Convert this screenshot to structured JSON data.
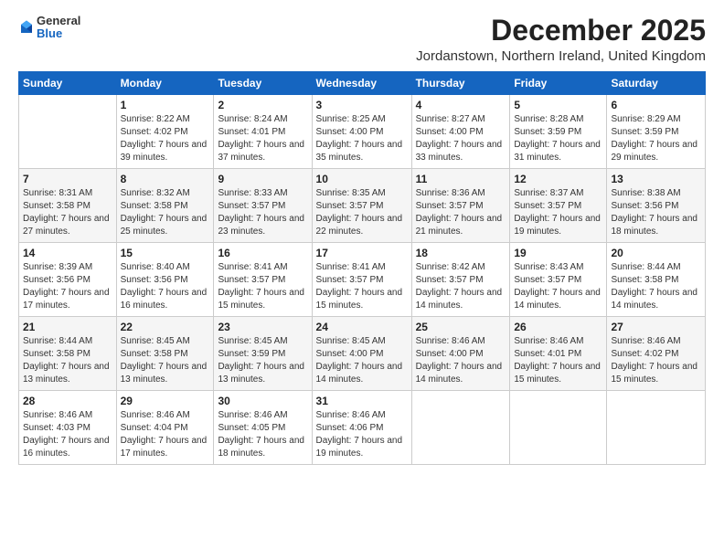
{
  "header": {
    "logo_general": "General",
    "logo_blue": "Blue",
    "month_title": "December 2025",
    "location": "Jordanstown, Northern Ireland, United Kingdom"
  },
  "weekdays": [
    "Sunday",
    "Monday",
    "Tuesday",
    "Wednesday",
    "Thursday",
    "Friday",
    "Saturday"
  ],
  "weeks": [
    [
      {
        "day": "",
        "sunrise": "",
        "sunset": "",
        "daylight": ""
      },
      {
        "day": "1",
        "sunrise": "Sunrise: 8:22 AM",
        "sunset": "Sunset: 4:02 PM",
        "daylight": "Daylight: 7 hours and 39 minutes."
      },
      {
        "day": "2",
        "sunrise": "Sunrise: 8:24 AM",
        "sunset": "Sunset: 4:01 PM",
        "daylight": "Daylight: 7 hours and 37 minutes."
      },
      {
        "day": "3",
        "sunrise": "Sunrise: 8:25 AM",
        "sunset": "Sunset: 4:00 PM",
        "daylight": "Daylight: 7 hours and 35 minutes."
      },
      {
        "day": "4",
        "sunrise": "Sunrise: 8:27 AM",
        "sunset": "Sunset: 4:00 PM",
        "daylight": "Daylight: 7 hours and 33 minutes."
      },
      {
        "day": "5",
        "sunrise": "Sunrise: 8:28 AM",
        "sunset": "Sunset: 3:59 PM",
        "daylight": "Daylight: 7 hours and 31 minutes."
      },
      {
        "day": "6",
        "sunrise": "Sunrise: 8:29 AM",
        "sunset": "Sunset: 3:59 PM",
        "daylight": "Daylight: 7 hours and 29 minutes."
      }
    ],
    [
      {
        "day": "7",
        "sunrise": "Sunrise: 8:31 AM",
        "sunset": "Sunset: 3:58 PM",
        "daylight": "Daylight: 7 hours and 27 minutes."
      },
      {
        "day": "8",
        "sunrise": "Sunrise: 8:32 AM",
        "sunset": "Sunset: 3:58 PM",
        "daylight": "Daylight: 7 hours and 25 minutes."
      },
      {
        "day": "9",
        "sunrise": "Sunrise: 8:33 AM",
        "sunset": "Sunset: 3:57 PM",
        "daylight": "Daylight: 7 hours and 23 minutes."
      },
      {
        "day": "10",
        "sunrise": "Sunrise: 8:35 AM",
        "sunset": "Sunset: 3:57 PM",
        "daylight": "Daylight: 7 hours and 22 minutes."
      },
      {
        "day": "11",
        "sunrise": "Sunrise: 8:36 AM",
        "sunset": "Sunset: 3:57 PM",
        "daylight": "Daylight: 7 hours and 21 minutes."
      },
      {
        "day": "12",
        "sunrise": "Sunrise: 8:37 AM",
        "sunset": "Sunset: 3:57 PM",
        "daylight": "Daylight: 7 hours and 19 minutes."
      },
      {
        "day": "13",
        "sunrise": "Sunrise: 8:38 AM",
        "sunset": "Sunset: 3:56 PM",
        "daylight": "Daylight: 7 hours and 18 minutes."
      }
    ],
    [
      {
        "day": "14",
        "sunrise": "Sunrise: 8:39 AM",
        "sunset": "Sunset: 3:56 PM",
        "daylight": "Daylight: 7 hours and 17 minutes."
      },
      {
        "day": "15",
        "sunrise": "Sunrise: 8:40 AM",
        "sunset": "Sunset: 3:56 PM",
        "daylight": "Daylight: 7 hours and 16 minutes."
      },
      {
        "day": "16",
        "sunrise": "Sunrise: 8:41 AM",
        "sunset": "Sunset: 3:57 PM",
        "daylight": "Daylight: 7 hours and 15 minutes."
      },
      {
        "day": "17",
        "sunrise": "Sunrise: 8:41 AM",
        "sunset": "Sunset: 3:57 PM",
        "daylight": "Daylight: 7 hours and 15 minutes."
      },
      {
        "day": "18",
        "sunrise": "Sunrise: 8:42 AM",
        "sunset": "Sunset: 3:57 PM",
        "daylight": "Daylight: 7 hours and 14 minutes."
      },
      {
        "day": "19",
        "sunrise": "Sunrise: 8:43 AM",
        "sunset": "Sunset: 3:57 PM",
        "daylight": "Daylight: 7 hours and 14 minutes."
      },
      {
        "day": "20",
        "sunrise": "Sunrise: 8:44 AM",
        "sunset": "Sunset: 3:58 PM",
        "daylight": "Daylight: 7 hours and 14 minutes."
      }
    ],
    [
      {
        "day": "21",
        "sunrise": "Sunrise: 8:44 AM",
        "sunset": "Sunset: 3:58 PM",
        "daylight": "Daylight: 7 hours and 13 minutes."
      },
      {
        "day": "22",
        "sunrise": "Sunrise: 8:45 AM",
        "sunset": "Sunset: 3:58 PM",
        "daylight": "Daylight: 7 hours and 13 minutes."
      },
      {
        "day": "23",
        "sunrise": "Sunrise: 8:45 AM",
        "sunset": "Sunset: 3:59 PM",
        "daylight": "Daylight: 7 hours and 13 minutes."
      },
      {
        "day": "24",
        "sunrise": "Sunrise: 8:45 AM",
        "sunset": "Sunset: 4:00 PM",
        "daylight": "Daylight: 7 hours and 14 minutes."
      },
      {
        "day": "25",
        "sunrise": "Sunrise: 8:46 AM",
        "sunset": "Sunset: 4:00 PM",
        "daylight": "Daylight: 7 hours and 14 minutes."
      },
      {
        "day": "26",
        "sunrise": "Sunrise: 8:46 AM",
        "sunset": "Sunset: 4:01 PM",
        "daylight": "Daylight: 7 hours and 15 minutes."
      },
      {
        "day": "27",
        "sunrise": "Sunrise: 8:46 AM",
        "sunset": "Sunset: 4:02 PM",
        "daylight": "Daylight: 7 hours and 15 minutes."
      }
    ],
    [
      {
        "day": "28",
        "sunrise": "Sunrise: 8:46 AM",
        "sunset": "Sunset: 4:03 PM",
        "daylight": "Daylight: 7 hours and 16 minutes."
      },
      {
        "day": "29",
        "sunrise": "Sunrise: 8:46 AM",
        "sunset": "Sunset: 4:04 PM",
        "daylight": "Daylight: 7 hours and 17 minutes."
      },
      {
        "day": "30",
        "sunrise": "Sunrise: 8:46 AM",
        "sunset": "Sunset: 4:05 PM",
        "daylight": "Daylight: 7 hours and 18 minutes."
      },
      {
        "day": "31",
        "sunrise": "Sunrise: 8:46 AM",
        "sunset": "Sunset: 4:06 PM",
        "daylight": "Daylight: 7 hours and 19 minutes."
      },
      {
        "day": "",
        "sunrise": "",
        "sunset": "",
        "daylight": ""
      },
      {
        "day": "",
        "sunrise": "",
        "sunset": "",
        "daylight": ""
      },
      {
        "day": "",
        "sunrise": "",
        "sunset": "",
        "daylight": ""
      }
    ]
  ]
}
